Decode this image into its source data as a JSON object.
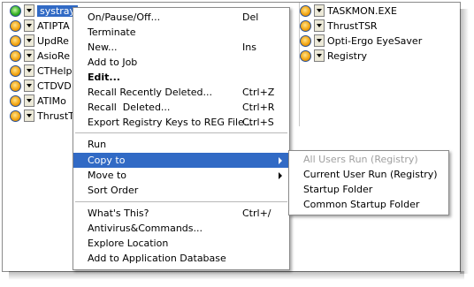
{
  "left_list": [
    {
      "name": "systray",
      "status": "green",
      "selected": true
    },
    {
      "name": "ATIPTA",
      "status": "orange"
    },
    {
      "name": "UpdRe",
      "status": "orange"
    },
    {
      "name": "AsioRe",
      "status": "orange"
    },
    {
      "name": "CTHelp",
      "status": "orange"
    },
    {
      "name": "CTDVD",
      "status": "orange"
    },
    {
      "name": "ATIMo",
      "status": "orange"
    },
    {
      "name": "ThrustT",
      "status": "orange"
    }
  ],
  "right_list": [
    {
      "name": "TASKMON.EXE"
    },
    {
      "name": "ThrustTSR"
    },
    {
      "name": "Opti-Ergo EyeSaver"
    },
    {
      "name": "Registry"
    }
  ],
  "context_menu": {
    "items": [
      {
        "label": "On/Pause/Off...",
        "shortcut": "Del"
      },
      {
        "label": "Terminate",
        "shortcut": ""
      },
      {
        "label": "New...",
        "shortcut": "Ins"
      },
      {
        "label": "Add to Job",
        "shortcut": ""
      },
      {
        "label": "Edit...",
        "shortcut": "",
        "bold": true
      },
      {
        "label": "Recall Recently Deleted...",
        "shortcut": "Ctrl+Z"
      },
      {
        "label": "Recall  Deleted...",
        "shortcut": "Ctrl+R"
      },
      {
        "label": "Export Registry Keys to REG File...",
        "shortcut": "Ctrl+S"
      },
      {
        "label": "Run",
        "shortcut": ""
      },
      {
        "label": "Copy to",
        "shortcut": "",
        "highlighted": true,
        "submenu": true
      },
      {
        "label": "Move to",
        "shortcut": "",
        "submenu": true
      },
      {
        "label": "Sort Order",
        "shortcut": ""
      },
      {
        "label": "What's This?",
        "shortcut": "Ctrl+/"
      },
      {
        "label": "Antivirus&Commands...",
        "shortcut": ""
      },
      {
        "label": "Explore Location",
        "shortcut": ""
      },
      {
        "label": "Add to Application Database",
        "shortcut": ""
      }
    ]
  },
  "submenu": {
    "items": [
      {
        "label": "All Users Run (Registry)",
        "disabled": true
      },
      {
        "label": "Current User Run (Registry)"
      },
      {
        "label": "Startup Folder"
      },
      {
        "label": "Common Startup Folder"
      }
    ]
  },
  "colors": {
    "highlight": "#316ac5",
    "status_orange": "#f3a512",
    "status_green": "#34b224"
  }
}
